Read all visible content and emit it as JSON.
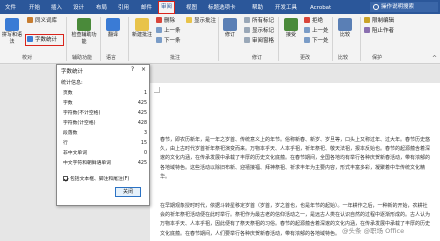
{
  "tabs": [
    "文件",
    "开始",
    "插入",
    "设计",
    "布局",
    "引用",
    "邮件",
    "审阅",
    "视图",
    "标题选项卡",
    "帮助",
    "开发工具",
    "Acrobat"
  ],
  "active_tab_index": 7,
  "search": {
    "text": "操作说明搜索",
    "icon": "lightbulb-icon"
  },
  "ribbon": {
    "proofing": {
      "big_button": "拼写和语法",
      "small": [
        "同义词库",
        "字数统计"
      ],
      "label": "校对"
    },
    "accessibility": {
      "big_button": "检查辅助功能",
      "label": "辅助功能"
    },
    "language": {
      "big_button": "翻译",
      "label": "语言"
    },
    "comments": {
      "new": "新建批注",
      "small": [
        "删除",
        "上一条",
        "下一条"
      ],
      "show": "显示批注",
      "label": "批注"
    },
    "tracking": {
      "small": [
        "修订",
        "所有标记",
        "显示标记",
        "审阅窗格"
      ],
      "label": "修订"
    },
    "changes": {
      "accept": "接受",
      "small": [
        "上一处",
        "下一处",
        "拒绝"
      ],
      "label": "更改"
    },
    "compare": {
      "big_button": "比较",
      "label": "比较"
    },
    "protect": {
      "small": [
        "限制编辑",
        "阻止作者"
      ],
      "label": "保护"
    }
  },
  "dialog": {
    "title": "字数统计",
    "help": "?",
    "close": "×",
    "stats_label": "统计信息:",
    "rows": [
      {
        "k": "页数",
        "v": "1"
      },
      {
        "k": "字数",
        "v": "425"
      },
      {
        "k": "字符数(不计空格)",
        "v": "425"
      },
      {
        "k": "字符数(计空格)",
        "v": "428"
      },
      {
        "k": "段落数",
        "v": "3"
      },
      {
        "k": "行",
        "v": "15"
      },
      {
        "k": "非中文单词",
        "v": "0"
      },
      {
        "k": "中文字符和朝鲜语单词",
        "v": "425"
      }
    ],
    "checkbox": "包括文本框、脚注和尾注(F)",
    "close_button": "关闭"
  },
  "document": {
    "paragraphs": [
      "春节，即农历新年，是一年之岁首、传统意义上的年节。俗称新春、新岁、岁旦等，口头上又称过年、过大年。春节历史悠久，由上古时代岁首祈年祭祀演变而来。万物本乎天、人本乎祖，祈年祭祀、敬天法祖，报本反始也。春节的起源蕴含着深邃的文化内涵，在传承发展中承载了丰厚的历史文化底蕴。在春节期间，全国各地均有举行各种庆贺新春活动，带有浓郁的各地域特色。这些活动以除旧布新、迎禧接福、拜神祭祖、祈求丰年为主要内容，形式丰富多彩，凝聚着中华传统文化精华。",
      "在早期观象授时时代，依据斗转星移定岁首（岁首，岁之首也，也是年节的起始）。一年耕作之后，一种新的开始，农耕社会的祈年祭祀活动便在此时举行。祭祀作为最古老的信仰活动之一，是远古人类在认识自然的过程中逐渐形成的。古人认为万物本乎天、人本乎祖，因此便有了祭天祭祖的习俗。春节的起源蕴含着深邃的文化内涵，在传承发展中承载了丰厚的历史文化底蕴。在春节期间，人们要举行各种庆贺新春活动，带有浓郁的各地域特色。"
    ]
  },
  "watermark": "@头条 @职场 Office",
  "colors": {
    "title_bar": "#2b579a",
    "highlight": "#d9241c"
  }
}
